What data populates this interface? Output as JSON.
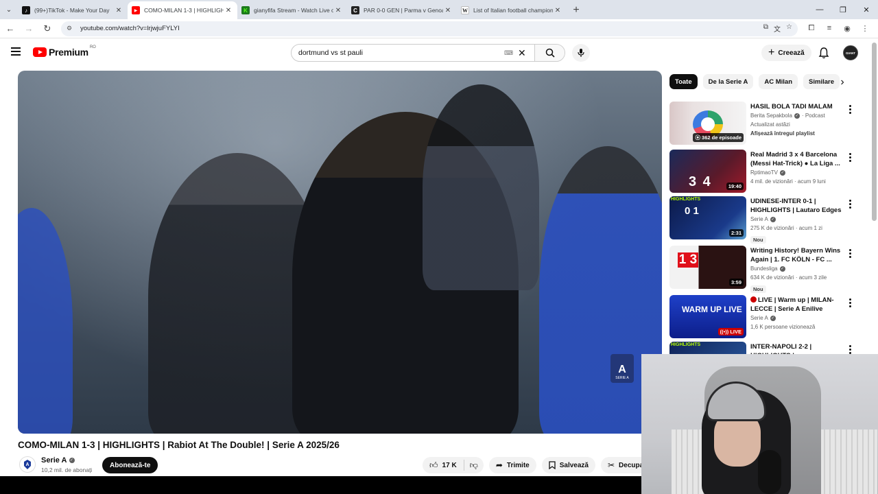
{
  "browser": {
    "tabs": [
      {
        "title": "(99+)TikTok - Make Your Day",
        "active": false,
        "favicon": "tiktok-icon",
        "color": "#111111",
        "glyph": "♪"
      },
      {
        "title": "COMO-MILAN 1-3 | HIGHLIGHTS",
        "active": true,
        "favicon": "youtube-icon",
        "color": "#ff0000",
        "glyph": "▶"
      },
      {
        "title": "gianyfifa Stream - Watch Live on",
        "active": false,
        "favicon": "kick-icon",
        "color": "#1b7a1b",
        "glyph": "K"
      },
      {
        "title": "PAR 0-0 GEN | Parma v Genoa",
        "active": false,
        "favicon": "score-icon",
        "color": "#222222",
        "glyph": "C"
      },
      {
        "title": "List of Italian football champion",
        "active": false,
        "favicon": "wikipedia-icon",
        "color": "#ffffff",
        "glyph": "W"
      }
    ],
    "url": "youtube.com/watch?v=lrjwjuFYLYI"
  },
  "masthead": {
    "logo_text": "Premium",
    "country": "RO",
    "search_value": "dortmund vs st pauli",
    "create_label": "Creează",
    "avatar_text": "GIANT"
  },
  "video": {
    "title": "COMO-MILAN 1-3 | HIGHLIGHTS | Rabiot At The Double! | Serie A 2025/26",
    "watermark": "SERIE A",
    "channel": "Serie A",
    "subscribers": "10,2 mil. de abonați",
    "subscribe_label": "Abonează-te",
    "likes": "17 K",
    "share_label": "Trimite",
    "save_label": "Salvează",
    "clip_label": "Decupaj"
  },
  "chips": [
    "Toate",
    "De la Serie A",
    "AC Milan",
    "Similare"
  ],
  "recommendations": [
    {
      "title": "HASIL BOLA TADI MALAM",
      "channel": "Berita Sepakbola",
      "extra": "· Podcast",
      "line2": "Actualizat astăzi",
      "line3": "Afișează întregul playlist",
      "badge": "362 de episoade",
      "thumb": "t1"
    },
    {
      "title": "Real Madrid 3 x 4 Barcelona (Messi Hat-Trick) ● La Liga ...",
      "channel": "RptimaoTV",
      "line2": "4 mil. de vizionări · acum 9 luni",
      "badge": "19:40",
      "thumb": "t2",
      "thumb_text": "3 4"
    },
    {
      "title": "UDINESE-INTER 0-1 | HIGHLIGHTS | Lautaro Edges ...",
      "channel": "Serie A",
      "line2": "275 K de vizionări · acum 1 zi",
      "new": "Nou",
      "badge": "2:31",
      "thumb": "t3",
      "thumb_text": "0 1",
      "thumb_tag": "HIGHLIGHTS"
    },
    {
      "title": "Writing History! Bayern Wins Again | 1. FC KÖLN - FC ...",
      "channel": "Bundesliga",
      "line2": "634 K de vizionări · acum 3 zile",
      "new": "Nou",
      "badge": "3:59",
      "thumb": "t4",
      "thumb_text": "1 3"
    },
    {
      "title": "LIVE | Warm up | MILAN-LECCE | Serie A Enilive 2025/26",
      "channel": "Serie A",
      "line2": "1,6 K persoane vizionează",
      "badge": "LIVE",
      "thumb": "t5",
      "thumb_text": "WARM UP LIVE"
    },
    {
      "title": "INTER-NAPOLI 2-2 | HIGHLIGHTS | ...",
      "channel": "",
      "line2": "",
      "badge": "",
      "thumb": "t6",
      "thumb_tag": "HIGHLIGHTS"
    }
  ]
}
